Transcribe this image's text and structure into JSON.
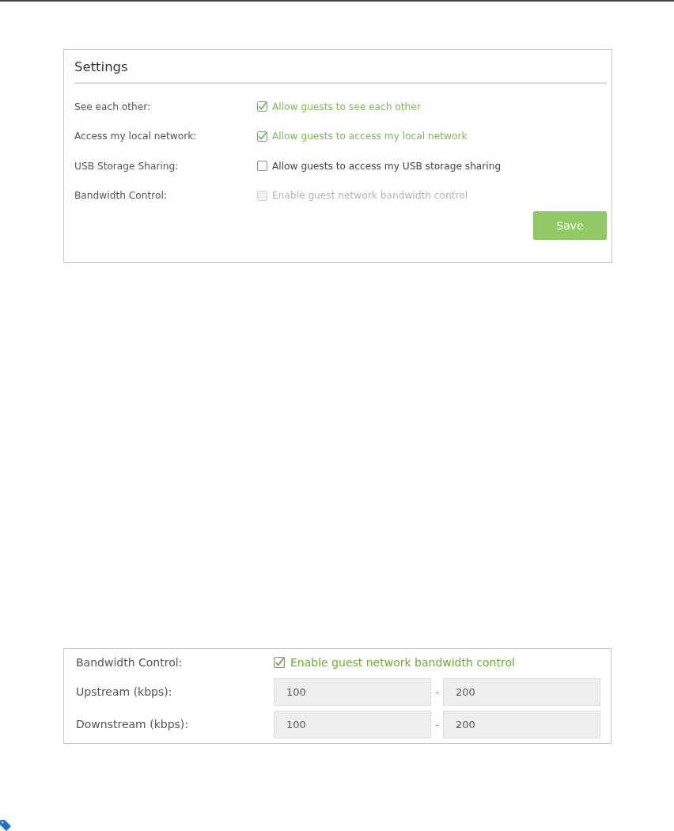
{
  "settings_panel": {
    "title": "Settings",
    "rows": [
      {
        "label": "See each other:",
        "option": "Allow guests to see each other",
        "checked": true,
        "disabled": false
      },
      {
        "label": "Access my local network:",
        "option": "Allow guests to access my local network",
        "checked": true,
        "disabled": false
      },
      {
        "label": "USB Storage Sharing:",
        "option": "Allow guests to access my USB storage sharing",
        "checked": false,
        "disabled": false
      },
      {
        "label": "Bandwidth Control:",
        "option": "Enable guest network bandwidth control",
        "checked": false,
        "disabled": true
      }
    ],
    "save_button": "Save"
  },
  "bandwidth_panel": {
    "rows": [
      {
        "kind": "checkbox",
        "label": "Bandwidth Control:",
        "option": "Enable guest network bandwidth control",
        "checked": true
      },
      {
        "kind": "range",
        "label": "Upstream (kbps):",
        "from": "100",
        "separator": "-",
        "to": "200"
      },
      {
        "kind": "range",
        "label": "Downstream (kbps):",
        "from": "100",
        "separator": "-",
        "to": "200"
      }
    ]
  }
}
